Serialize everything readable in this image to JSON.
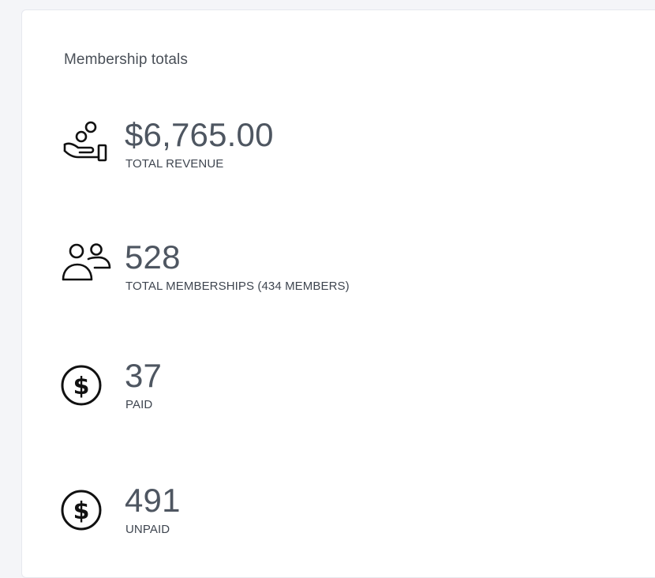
{
  "card": {
    "title": "Membership totals"
  },
  "stats": [
    {
      "icon": "hand-coins-icon",
      "value": "$6,765.00",
      "label": "TOTAL REVENUE"
    },
    {
      "icon": "users-icon",
      "value": "528",
      "label": "TOTAL MEMBERSHIPS (434 MEMBERS)"
    },
    {
      "icon": "dollar-circle-icon",
      "value": "37",
      "label": "PAID"
    },
    {
      "icon": "dollar-circle-icon",
      "value": "491",
      "label": "UNPAID"
    }
  ],
  "colors": {
    "text_primary": "#4e5661",
    "text_label": "#3f4650",
    "icon_stroke": "#111111",
    "page_bg": "#f4f5f8",
    "card_bg": "#ffffff"
  }
}
